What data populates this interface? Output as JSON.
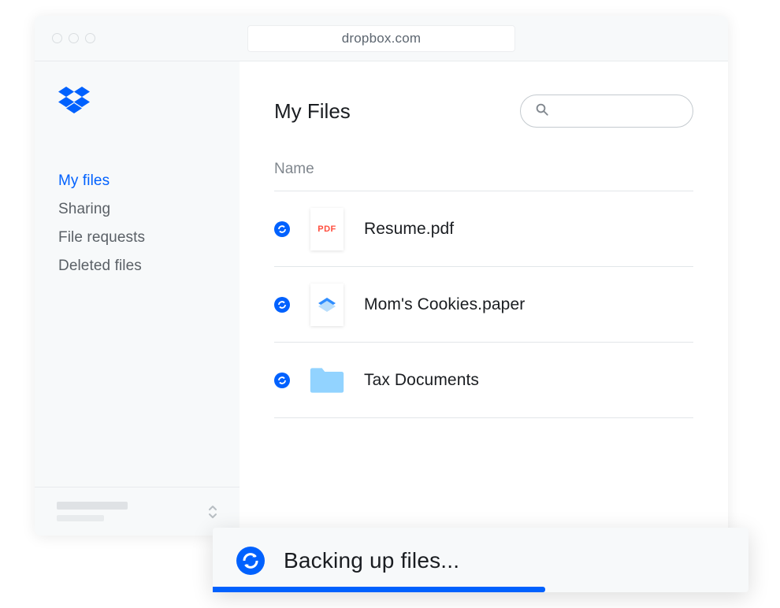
{
  "browser": {
    "url_display": "dropbox.com"
  },
  "sidebar": {
    "items": [
      {
        "label": "My files",
        "active": true
      },
      {
        "label": "Sharing",
        "active": false
      },
      {
        "label": "File requests",
        "active": false
      },
      {
        "label": "Deleted files",
        "active": false
      }
    ]
  },
  "main": {
    "title": "My Files",
    "search_placeholder": "",
    "column_header": "Name",
    "files": [
      {
        "name": "Resume.pdf",
        "icon_type": "pdf",
        "pdf_label": "PDF"
      },
      {
        "name": "Mom's Cookies.paper",
        "icon_type": "paper"
      },
      {
        "name": "Tax Documents",
        "icon_type": "folder"
      }
    ]
  },
  "status": {
    "message": "Backing up files...",
    "progress_percent": 62
  },
  "colors": {
    "accent": "#0061fe",
    "folder": "#92d3ff",
    "pdf_label": "#ff4d3d"
  }
}
